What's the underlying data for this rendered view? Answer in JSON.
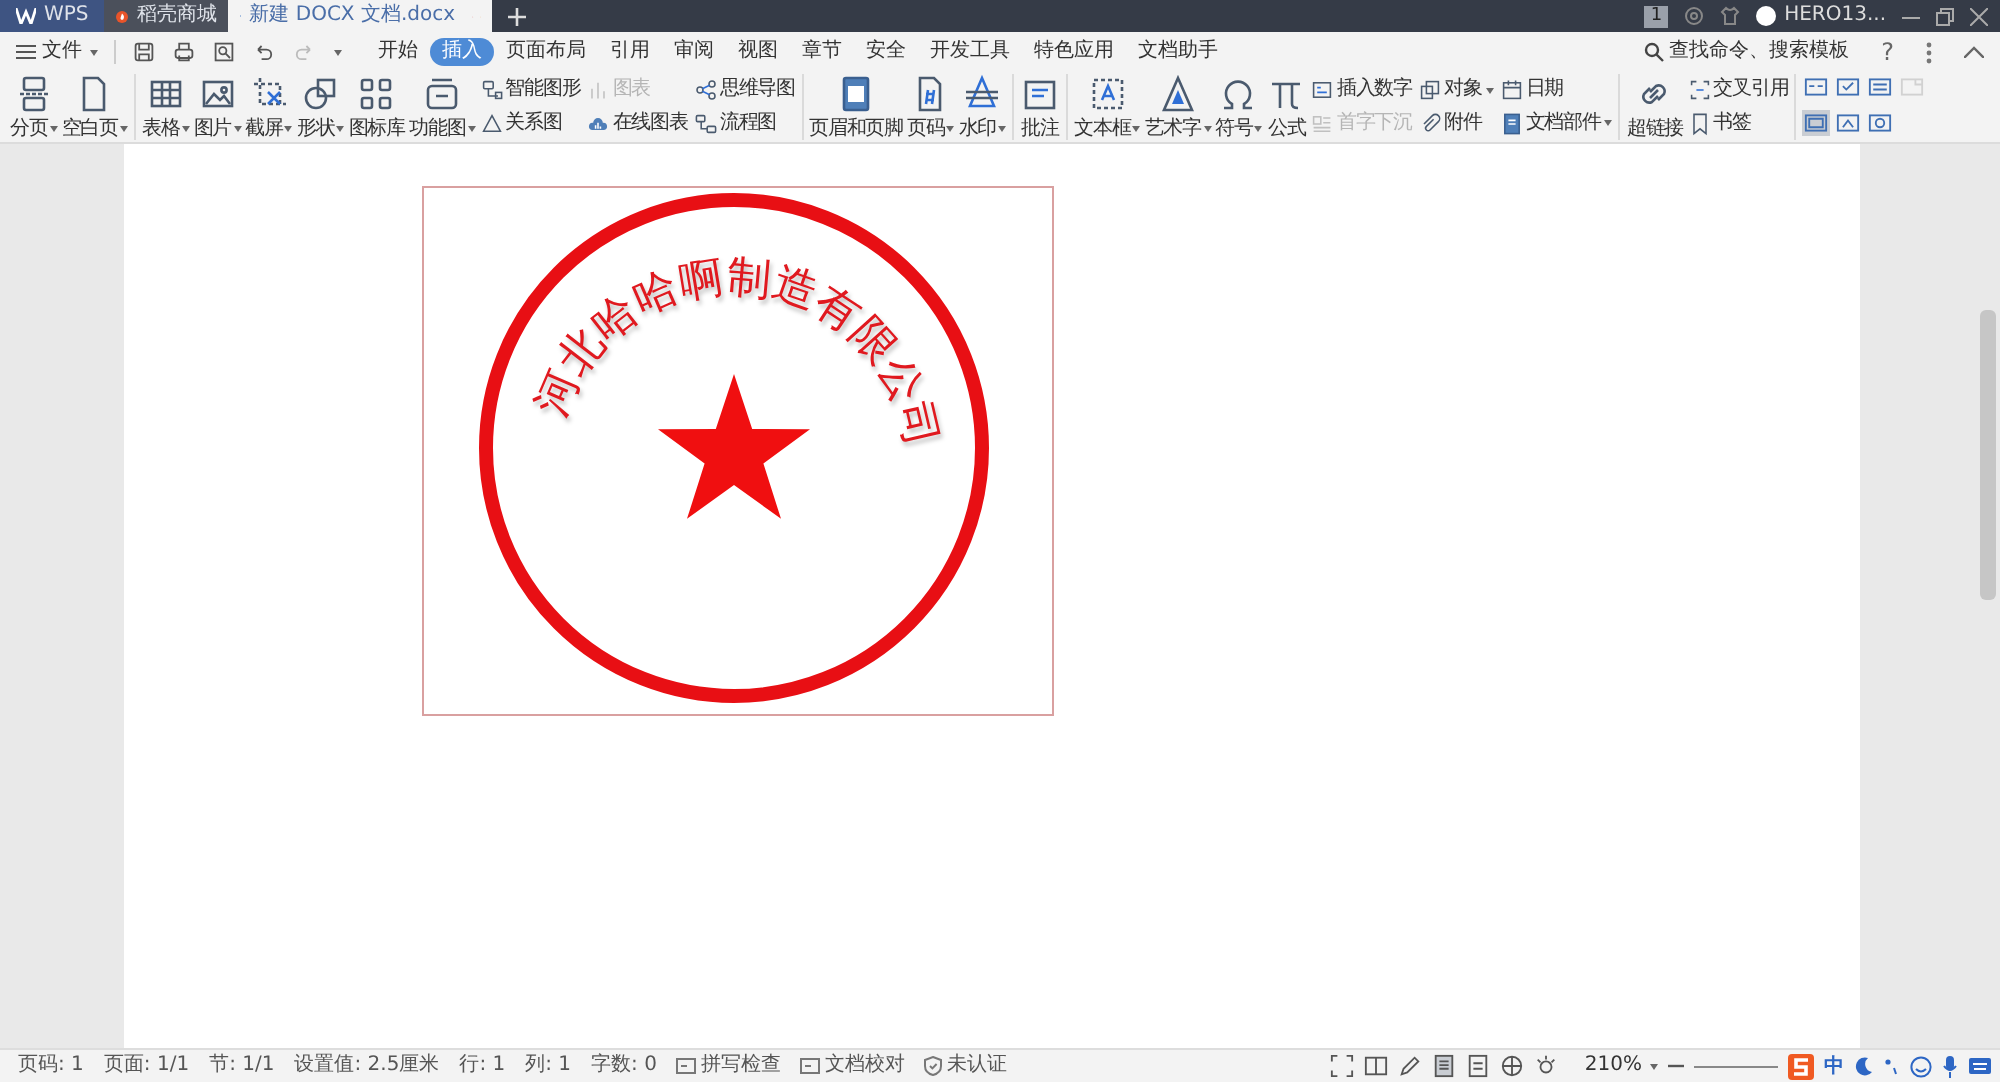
{
  "title_bar": {
    "tabs": [
      {
        "label": "WPS",
        "kind": "app",
        "selected": false,
        "warning": false,
        "unsaved": false
      },
      {
        "label": "稻壳商城",
        "kind": "store",
        "selected": false,
        "warning": false,
        "unsaved": false
      },
      {
        "label": "新建 DOCX 文档.docx",
        "kind": "doc",
        "selected": true,
        "warning": true,
        "unsaved": true
      }
    ],
    "badge": "1",
    "user": "HERO13..."
  },
  "menu": {
    "label": "文件"
  },
  "tabs": [
    {
      "label": "开始",
      "selected": false
    },
    {
      "label": "插入",
      "selected": true
    },
    {
      "label": "页面布局",
      "selected": false
    },
    {
      "label": "引用",
      "selected": false
    },
    {
      "label": "审阅",
      "selected": false
    },
    {
      "label": "视图",
      "selected": false
    },
    {
      "label": "章节",
      "selected": false
    },
    {
      "label": "安全",
      "selected": false
    },
    {
      "label": "开发工具",
      "selected": false
    },
    {
      "label": "特色应用",
      "selected": false
    },
    {
      "label": "文档助手",
      "selected": false
    }
  ],
  "search": {
    "label": "查找命令、搜索模板"
  },
  "help": "?",
  "ribbon": {
    "groups": [
      {
        "large": [
          {
            "label": "分页",
            "dropdown": true
          },
          {
            "label": "空白页",
            "dropdown": true
          }
        ]
      },
      {
        "large": [
          {
            "label": "表格",
            "dropdown": true
          },
          {
            "label": "图片",
            "dropdown": true
          },
          {
            "label": "截屏",
            "dropdown": true
          },
          {
            "label": "形状",
            "dropdown": true
          },
          {
            "label": "图标库",
            "dropdown": false
          },
          {
            "label": "功能图",
            "dropdown": true
          }
        ],
        "small": [
          {
            "label": "智能图形",
            "dropdown": false,
            "disabled": false
          },
          {
            "label": "关系图",
            "dropdown": false,
            "disabled": false
          },
          {
            "label": "图表",
            "dropdown": false,
            "disabled": true
          },
          {
            "label": "在线图表",
            "dropdown": false,
            "disabled": false
          },
          {
            "label": "思维导图",
            "dropdown": false,
            "disabled": false
          },
          {
            "label": "流程图",
            "dropdown": false,
            "disabled": false
          }
        ]
      },
      {
        "large": [
          {
            "label": "页眉和页脚",
            "dropdown": false
          },
          {
            "label": "页码",
            "dropdown": true
          },
          {
            "label": "水印",
            "dropdown": true
          }
        ]
      },
      {
        "large": [
          {
            "label": "批注",
            "dropdown": false
          }
        ]
      },
      {
        "large": [
          {
            "label": "文本框",
            "dropdown": true
          },
          {
            "label": "艺术字",
            "dropdown": true
          },
          {
            "label": "符号",
            "dropdown": true
          },
          {
            "label": "公式",
            "dropdown": false
          }
        ],
        "small": [
          {
            "label": "插入数字",
            "dropdown": false,
            "disabled": false
          },
          {
            "label": "首字下沉",
            "dropdown": false,
            "disabled": true
          },
          {
            "label": "对象",
            "dropdown": true,
            "disabled": false
          },
          {
            "label": "附件",
            "dropdown": false,
            "disabled": false
          },
          {
            "label": "日期",
            "dropdown": false,
            "disabled": false
          },
          {
            "label": "文档部件",
            "dropdown": true,
            "disabled": false
          }
        ]
      },
      {
        "large": [
          {
            "label": "超链接",
            "dropdown": false
          }
        ],
        "small": [
          {
            "label": "交叉引用",
            "dropdown": false,
            "disabled": false
          },
          {
            "label": "书签",
            "dropdown": false,
            "disabled": false
          }
        ]
      }
    ],
    "view_buttons": [
      {
        "selected": false,
        "disabled": false
      },
      {
        "selected": true,
        "disabled": false
      },
      {
        "selected": false,
        "disabled": false
      },
      {
        "selected": false,
        "disabled": false
      },
      {
        "selected": false,
        "disabled": false
      },
      {
        "selected": false,
        "disabled": false
      },
      {
        "selected": false,
        "disabled": true
      }
    ]
  },
  "document": {
    "stamp": {
      "text": "河北哈哈啊制造有限公司"
    }
  },
  "status_bar": {
    "items": [
      {
        "label": "页码: 1",
        "kind": "text"
      },
      {
        "label": "页面: 1/1",
        "kind": "text"
      },
      {
        "label": "节: 1/1",
        "kind": "text"
      },
      {
        "label": "设置值: 2.5厘米",
        "kind": "text"
      },
      {
        "label": "行: 1",
        "kind": "text"
      },
      {
        "label": "列: 1",
        "kind": "text"
      },
      {
        "label": "字数: 0",
        "kind": "text"
      },
      {
        "label": "拼写检查",
        "kind": "check"
      },
      {
        "label": "文档校对",
        "kind": "check"
      },
      {
        "label": "未认证",
        "kind": "cert"
      }
    ],
    "zoom": "210%",
    "ime": "中"
  }
}
